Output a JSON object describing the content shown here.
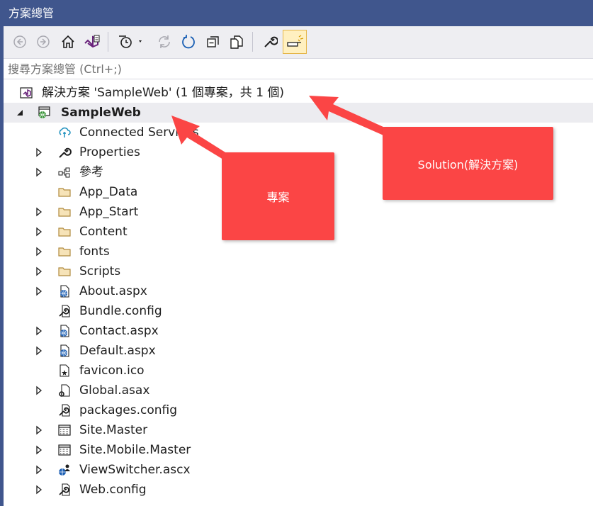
{
  "window": {
    "title": "方案總管"
  },
  "toolbar": {
    "buttons": [
      {
        "name": "back-button",
        "icon": "back-arrow-icon"
      },
      {
        "name": "forward-button",
        "icon": "forward-arrow-icon"
      },
      {
        "name": "home-button",
        "icon": "home-icon"
      },
      {
        "name": "switch-view-button",
        "icon": "visual-studio-icon"
      },
      {
        "name": "pending-changes-filter-button",
        "icon": "clock-filter-icon"
      },
      {
        "name": "sync-button",
        "icon": "sync-icon"
      },
      {
        "name": "refresh-button",
        "icon": "refresh-icon"
      },
      {
        "name": "collapse-all-button",
        "icon": "collapse-all-icon"
      },
      {
        "name": "show-all-files-button",
        "icon": "show-all-files-icon"
      },
      {
        "name": "properties-button",
        "icon": "wrench-icon"
      },
      {
        "name": "preview-selected-button",
        "icon": "preview-icon"
      }
    ]
  },
  "search": {
    "placeholder": "搜尋方案總管 (Ctrl+;)",
    "value": ""
  },
  "tree": {
    "solution": "解決方案 'SampleWeb' (1 個專案，共 1 個)",
    "project": "SampleWeb",
    "items": [
      {
        "label": "Connected Services",
        "icon": "connected-services-icon",
        "expandable": false
      },
      {
        "label": "Properties",
        "icon": "wrench-icon",
        "expandable": true
      },
      {
        "label": "參考",
        "icon": "references-icon",
        "expandable": true
      },
      {
        "label": "App_Data",
        "icon": "folder-icon",
        "expandable": false
      },
      {
        "label": "App_Start",
        "icon": "folder-icon",
        "expandable": true
      },
      {
        "label": "Content",
        "icon": "folder-icon",
        "expandable": true
      },
      {
        "label": "fonts",
        "icon": "folder-icon",
        "expandable": true
      },
      {
        "label": "Scripts",
        "icon": "folder-icon",
        "expandable": true
      },
      {
        "label": "About.aspx",
        "icon": "web-page-icon",
        "expandable": true
      },
      {
        "label": "Bundle.config",
        "icon": "config-file-icon",
        "expandable": false
      },
      {
        "label": "Contact.aspx",
        "icon": "web-page-icon",
        "expandable": true
      },
      {
        "label": "Default.aspx",
        "icon": "web-page-icon",
        "expandable": true
      },
      {
        "label": "favicon.ico",
        "icon": "icon-file-icon",
        "expandable": false
      },
      {
        "label": "Global.asax",
        "icon": "global-asax-icon",
        "expandable": true
      },
      {
        "label": "packages.config",
        "icon": "config-file-icon",
        "expandable": false
      },
      {
        "label": "Site.Master",
        "icon": "master-page-icon",
        "expandable": true
      },
      {
        "label": "Site.Mobile.Master",
        "icon": "master-page-icon",
        "expandable": true
      },
      {
        "label": "ViewSwitcher.ascx",
        "icon": "user-control-icon",
        "expandable": true
      },
      {
        "label": "Web.config",
        "icon": "config-file-icon",
        "expandable": true
      }
    ]
  },
  "annotations": {
    "project_callout": "專案",
    "solution_callout": "Solution(解決方案)"
  },
  "colors": {
    "titlebar": "#40568d",
    "callout": "#fb4545",
    "folder": "#dcb67a",
    "vs_purple": "#68217a"
  }
}
